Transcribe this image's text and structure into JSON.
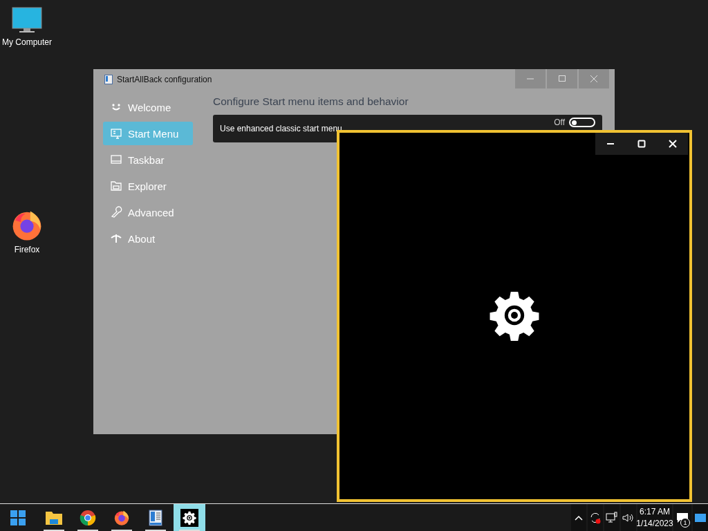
{
  "desktop_icons": [
    {
      "kind": "computer",
      "label": "My Computer"
    },
    {
      "kind": "firefox",
      "label": "Firefox"
    }
  ],
  "config_window": {
    "title": "StartAllBack configuration",
    "nav": [
      {
        "kind": "smile",
        "label": "Welcome",
        "selected": false
      },
      {
        "kind": "startmenu",
        "label": "Start Menu",
        "selected": true
      },
      {
        "kind": "taskbar",
        "label": "Taskbar",
        "selected": false
      },
      {
        "kind": "folder",
        "label": "Explorer",
        "selected": false
      },
      {
        "kind": "wrench",
        "label": "Advanced",
        "selected": false
      },
      {
        "kind": "about",
        "label": "About",
        "selected": false
      }
    ],
    "heading": "Configure Start menu items and behavior",
    "option": {
      "label": "Use enhanced classic start menu",
      "toggle_text": "Off",
      "on": false
    }
  },
  "taskbar": {
    "apps": [
      {
        "kind": "files",
        "active": false
      },
      {
        "kind": "chrome",
        "active": false
      },
      {
        "kind": "firefox",
        "active": false
      },
      {
        "kind": "startallback",
        "active": false
      },
      {
        "kind": "settings",
        "active": true
      }
    ],
    "time": "6:17 AM",
    "date": "1/14/2023",
    "notification_count": "1"
  }
}
